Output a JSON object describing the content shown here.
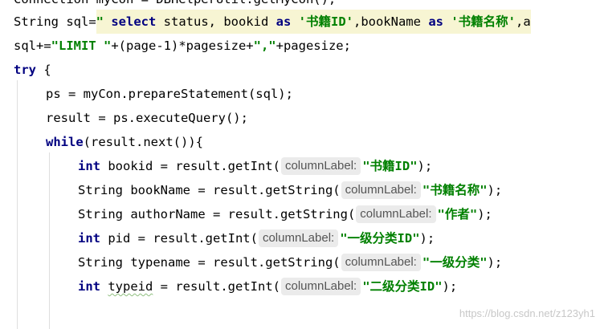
{
  "code": {
    "line0": {
      "text": "Connection myCon = DBHelperUtil.getMyCon();"
    },
    "line1": {
      "p1": "String sql=",
      "q1": "\" ",
      "k1": "select",
      "t1": " status, bookid ",
      "k2": "as",
      "t2": " ",
      "s1": "'书籍ID'",
      "t3": ",bookName ",
      "k3": "as",
      "t4": " ",
      "s2": "'书籍名称'",
      "t5": ",a"
    },
    "line2": {
      "p1": "sql+=",
      "s1": "\"LIMIT \"",
      "p2": "+(page-1)*pagesize+",
      "s2": "\",\"",
      "p3": "+pagesize;"
    },
    "line3": {
      "kw": "try",
      "rest": " {"
    },
    "line4": {
      "text": "ps = myCon.prepareStatement(sql);"
    },
    "line5": {
      "text": "result = ps.executeQuery();"
    },
    "line6": {
      "kw": "while",
      "rest": "(result.next()){"
    },
    "line7": {
      "type": "int",
      "mid": " bookid = result.getInt(",
      "hint": "columnLabel:",
      "str": "\"书籍ID\"",
      "end": ");"
    },
    "line8": {
      "type": "String",
      "mid": " bookName = result.getString(",
      "hint": "columnLabel:",
      "str": "\"书籍名称\"",
      "end": ");"
    },
    "line9": {
      "type": "String",
      "mid": " authorName = result.getString(",
      "hint": "columnLabel:",
      "str": "\"作者\"",
      "end": ");"
    },
    "line10": {
      "type": "int",
      "mid": " pid = result.getInt(",
      "hint": "columnLabel:",
      "str": "\"一级分类ID\"",
      "end": ");"
    },
    "line11": {
      "type": "String",
      "mid": " typename = result.getString(",
      "hint": "columnLabel:",
      "str": "\"一级分类\"",
      "end": ");"
    },
    "line12": {
      "type": "int",
      "mid1": " ",
      "var": "typeid",
      "mid2": " = result.getInt(",
      "hint": "columnLabel:",
      "str": "\"二级分类ID\"",
      "end": ");"
    }
  },
  "watermark": "https://blog.csdn.net/z123yh1",
  "colors": {
    "keyword": "#000080",
    "string": "#008000",
    "highlight": "#f7f5d3",
    "hint_bg": "#ebebeb"
  }
}
